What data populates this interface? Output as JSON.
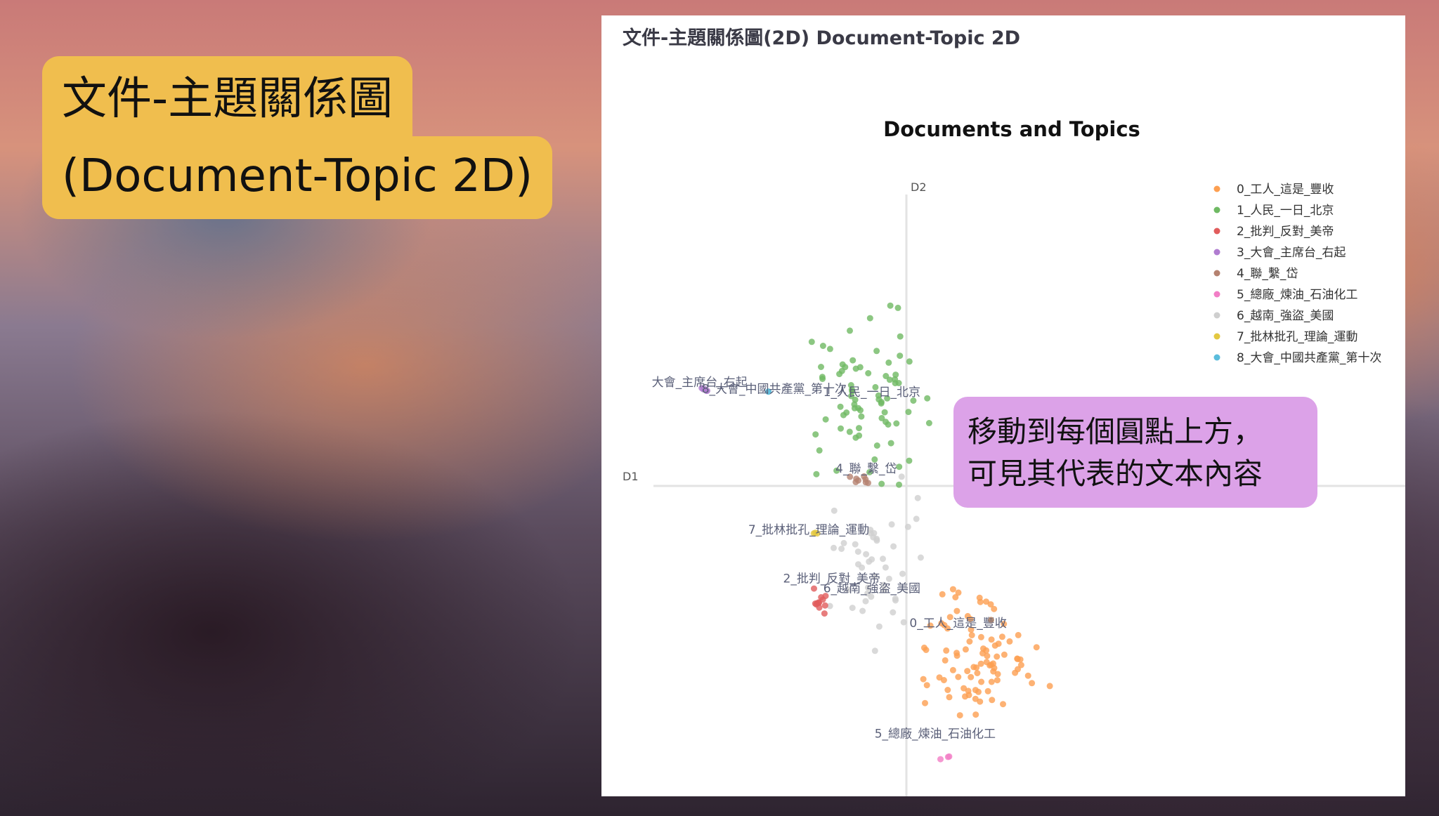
{
  "slide": {
    "title_line1": "文件-主題關係圖",
    "title_line2": "(Document-Topic 2D)",
    "callout_line1": "移動到每個圓點上方，",
    "callout_line2": "可見其代表的文本內容"
  },
  "panel": {
    "header": "文件-主題關係圖(2D) Document-Topic 2D"
  },
  "chart_data": {
    "type": "scatter",
    "title": "Documents and Topics",
    "xlabel": "D1",
    "ylabel": "D2",
    "legend_position": "top-right",
    "grid": false,
    "xlim": [
      -4.5,
      9.0
    ],
    "ylim": [
      -4.6,
      4.6
    ],
    "series": [
      {
        "name": "0_工人_這是_豐收",
        "color": "#fd9f51",
        "center": [
          1.3,
          -2.5
        ],
        "spread": [
          1.5,
          1.3
        ],
        "count": 90
      },
      {
        "name": "1_人民_一日_北京",
        "color": "#6fb963",
        "center": [
          -0.6,
          1.3
        ],
        "spread": [
          1.3,
          1.8
        ],
        "count": 75
      },
      {
        "name": "2_批判_反對_美帝",
        "color": "#e15c5c",
        "center": [
          -1.5,
          -1.7
        ],
        "spread": [
          0.15,
          0.45
        ],
        "count": 12
      },
      {
        "name": "3_大會_主席台_右起",
        "color": "#b07cd0",
        "center": [
          -3.5,
          1.45
        ],
        "spread": [
          0.15,
          0.05
        ],
        "count": 5
      },
      {
        "name": "4_聯_繫_岱",
        "color": "#b58270",
        "center": [
          -0.8,
          0.1
        ],
        "spread": [
          0.25,
          0.1
        ],
        "count": 8
      },
      {
        "name": "5_總廠_煉油_石油化工",
        "color": "#f27ec6",
        "center": [
          0.7,
          -4.1
        ],
        "spread": [
          0.15,
          0.1
        ],
        "count": 3
      },
      {
        "name": "6_越南_強盜_美國",
        "color": "#cfcfcf",
        "center": [
          -0.4,
          -1.2
        ],
        "spread": [
          1.2,
          1.6
        ],
        "count": 45
      },
      {
        "name": "7_批林批孔_理論_運動",
        "color": "#e3c841",
        "center": [
          -1.6,
          -0.7
        ],
        "spread": [
          0.1,
          0.05
        ],
        "count": 3
      },
      {
        "name": "8_大會_中國共產黨_第十次",
        "color": "#5bbddc",
        "center": [
          -2.4,
          1.4
        ],
        "spread": [
          0.1,
          0.05
        ],
        "count": 2
      }
    ],
    "annotations": [
      {
        "text": "大會_主席台_右起",
        "x": -3.6,
        "y": 1.5
      },
      {
        "text": "8_大會_中國共產黨_第十次",
        "x": -2.3,
        "y": 1.4
      },
      {
        "text": "1_人民_一日_北京",
        "x": -0.6,
        "y": 1.35
      },
      {
        "text": "4_聯_繫_岱",
        "x": -0.7,
        "y": 0.2
      },
      {
        "text": "7_批林批孔_理論_運動",
        "x": -1.7,
        "y": -0.72
      },
      {
        "text": "2_批判_反對_美帝",
        "x": -1.3,
        "y": -1.45
      },
      {
        "text": "6_越南_強盜_美國",
        "x": -0.6,
        "y": -1.6
      },
      {
        "text": "0_工人_這是_豐收",
        "x": 0.9,
        "y": -2.12
      },
      {
        "text": "5_總廠_煉油_石油化工",
        "x": 0.5,
        "y": -3.78
      }
    ]
  }
}
